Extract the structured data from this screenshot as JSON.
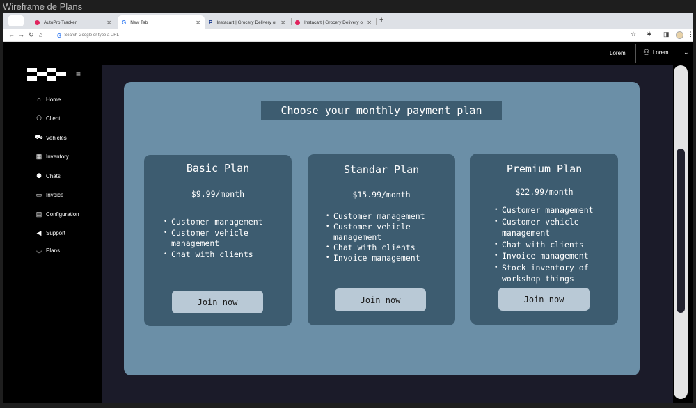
{
  "frame_label": "Wireframe de Plans",
  "browser": {
    "tabs": [
      {
        "title": "AutoPro Tracker",
        "icon": "autopro-favicon",
        "active": false
      },
      {
        "title": "New Tab",
        "icon": "google-icon",
        "active": true
      },
      {
        "title": "Instacart | Grocery Delivery or...",
        "icon": "paypal-favicon",
        "active": false
      },
      {
        "title": "Instacart | Grocery Delivery or...",
        "icon": "instacart-favicon",
        "active": false
      }
    ],
    "new_tab": "+",
    "address_placeholder": "Search Google or type a URL"
  },
  "topbar": {
    "lorem": "Lorem",
    "user_label": "Lorem"
  },
  "sidebar": {
    "items": [
      {
        "label": "Home",
        "icon": "home-icon",
        "glyph": "⌂"
      },
      {
        "label": "Client",
        "icon": "user-icon",
        "glyph": "⚇"
      },
      {
        "label": "Vehicles",
        "icon": "car-icon",
        "glyph": "⛟"
      },
      {
        "label": "Inventory",
        "icon": "calendar-icon",
        "glyph": "▦"
      },
      {
        "label": "Chats",
        "icon": "people-icon",
        "glyph": "⚉"
      },
      {
        "label": "Invoice",
        "icon": "folder-icon",
        "glyph": "▭"
      },
      {
        "label": "Configuration",
        "icon": "document-icon",
        "glyph": "▤"
      },
      {
        "label": "Support",
        "icon": "megaphone-icon",
        "glyph": "◀"
      },
      {
        "label": "Plans",
        "icon": "basket-icon",
        "glyph": "◡"
      }
    ]
  },
  "main": {
    "heading": "Choose your monthly payment plan",
    "plans": [
      {
        "title": "Basic Plan",
        "price": "$9.99/month",
        "features": [
          "Customer management",
          "Customer vehicle management",
          "Chat with clients"
        ],
        "button": "Join now"
      },
      {
        "title": "Standar Plan",
        "price": "$15.99/month",
        "features": [
          "Customer management",
          "Customer vehicle management",
          "Chat with clients",
          "Invoice management"
        ],
        "button": "Join now"
      },
      {
        "title": "Premium Plan",
        "price": "$22.99/month",
        "features": [
          "Customer management",
          "Customer vehicle management",
          "Chat with clients",
          "Invoice management",
          "Stock inventory of workshop things"
        ],
        "button": "Join now"
      }
    ]
  },
  "colors": {
    "panel": "#6b8fa7",
    "card": "#3d5c70",
    "button": "#b9c9d6",
    "main_bg": "#1b1b29"
  }
}
